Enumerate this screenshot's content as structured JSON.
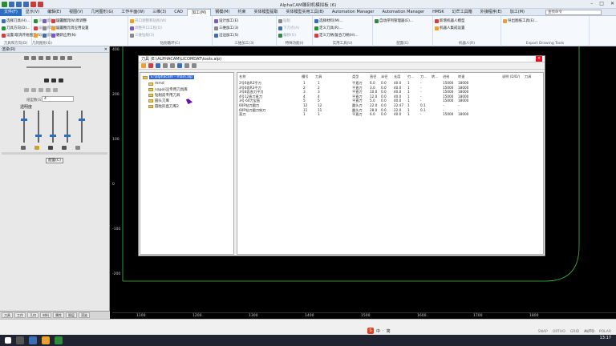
{
  "window": {
    "title": "AlphaCAM雕刻机模拟板 (6)"
  },
  "menu": {
    "tabs": [
      "文件(F)",
      "显示(V)",
      "编辑(E)",
      "视图(V)",
      "几何图形(G)",
      "工作平面(W)",
      "三维(3)",
      "CAD",
      "加工(M)",
      "钢模(M)",
      "约束",
      "实体模型提取",
      "实体模型实用工具(B)",
      "Automation Manager",
      "Automation Manager",
      "HMSK",
      "幻芒工具箱",
      "外接程序(E)",
      "加工(M)"
    ],
    "active_index": 8,
    "search_placeholder": "查找命令"
  },
  "ribbon": {
    "groups": [
      {
        "label": "刀具和方向(D)",
        "items": [
          "选择刀具(H)...",
          "刀具方向(D)...",
          "设置/取消开始图元(S)"
        ]
      },
      {
        "label": "几何图形(G)",
        "items": [
          "添加加工(A)...",
          "编辑加工(E)...",
          "三维加工(3)...",
          "粗加工和加工(R)...",
          "平面加工(P)...",
          "删除(D)"
        ]
      },
      {
        "label": "",
        "items": [
          "设置图元(V)周调整",
          "设置图元周应用设置",
          "更新应用(N)"
        ]
      },
      {
        "label": "钻削循环(C)",
        "items": [
          "开口调整和钻削(W)",
          "调整开口工程(D)",
          "三维钻削(3)"
        ]
      },
      {
        "label": "三维加工(3)",
        "items": [
          "设计加工(E)",
          "三维加工(3)",
          "沿边加工(S)"
        ]
      },
      {
        "label": "特殊功能(I)",
        "items": [
          "钻削",
          "下刀点(A)",
          "偏移(O)"
        ]
      },
      {
        "label": "实用工具(U)",
        "items": [
          "选择材料(M)...",
          "定义刀具(R)...",
          "定义刀柄/复合刀柄(H)..."
        ]
      },
      {
        "label": "配置(E)",
        "items": [
          "自动序列管理器(E)..."
        ]
      },
      {
        "label": "机器人(R)",
        "items": [
          "新增机器人模型",
          "机器人集成设置"
        ]
      },
      {
        "label": "Export Drawing Tools",
        "items": [
          "导出图纸工具(E)..."
        ]
      }
    ]
  },
  "left_panel": {
    "title": "渲染(R)",
    "paper_label": "纸型数(S)",
    "paper_value": "4",
    "transparency_label": "透明度",
    "sliders": [
      0.75,
      0.25,
      0.25,
      0.25,
      0.75
    ],
    "apply_label": "配置(C)",
    "tabs": [
      "刀具",
      "工作",
      "几何",
      "材料",
      "属性",
      "图层",
      "渲染"
    ]
  },
  "canvas": {
    "ruler_bottom": [
      "1100",
      "1200",
      "1300",
      "1400",
      "1500",
      "1600",
      "1700",
      "1800"
    ],
    "ruler_left": [
      "400",
      "200",
      "100",
      "0",
      "-100",
      "-200"
    ],
    "line_color": "#3fbf3f"
  },
  "dialog": {
    "title": "刀具 (E:\\ALPHACAM\\LICOMDAT\\tools.alp)",
    "close_label": "×",
    "tree": {
      "root": "E:\\alphacam - main.alp",
      "children": [
        "mmd",
        "napoli沿专用刀具库",
        "钻削前专用刀具",
        "圆头刀库",
        "圆柱形直刀库2"
      ]
    },
    "table": {
      "headers": [
        "名称",
        "槽号",
        "刀具",
        "",
        "",
        "类型",
        "直径",
        "半径",
        "长度",
        "刃...",
        "刀...",
        "转...",
        "进给",
        "转速",
        "",
        "",
        "",
        "",
        "",
        " ",
        "说明 (D/D/)",
        "刀具"
      ],
      "rows": [
        [
          "2号6齿R2平刀",
          "1",
          "1",
          "平直刀",
          "6.0",
          "0.0",
          "40.0",
          "1",
          "-",
          "15000",
          "18000"
        ],
        [
          "3号6齿R3平刀",
          "2",
          "2",
          "平直刀",
          "3.0",
          "0.0",
          "40.0",
          "1",
          "-",
          "15000",
          "18000"
        ],
        [
          "3号8齿直刀平刀",
          "3",
          "3",
          "平直刀",
          "10.0",
          "0.0",
          "40.0",
          "1",
          "-",
          "15000",
          "18000"
        ],
        [
          "4号12直刀直刀",
          "4",
          "4",
          "平直刀",
          "12.0",
          "0.0",
          "40.0",
          "1",
          "-",
          "15000",
          "18000"
        ],
        [
          "3号 60刀宝直",
          "5",
          "5",
          "平直刀",
          "5.0",
          "0.0",
          "40.0",
          "1",
          "-",
          "15000",
          "18000"
        ],
        [
          "60R钻刀圆刀",
          "12",
          "12",
          "圆头刀",
          "22.0",
          "0.0",
          "22.47",
          "1",
          "0.1",
          "-",
          "-"
        ],
        [
          "60R钻刀圆刀斜刀",
          "11",
          "11",
          "圆头刀",
          "28.0",
          "0.0",
          "22.0",
          "1",
          "0.1",
          "-",
          "-"
        ],
        [
          "直刀",
          "1",
          "1",
          "平直刀",
          "6.0",
          "0.0",
          "40.0",
          "1",
          "-",
          "15000",
          "18000"
        ]
      ]
    }
  },
  "statusbar": {
    "modes": [
      "SNAP",
      "ORTHO",
      "GRID",
      "AUTO",
      "POLAR"
    ],
    "active_mode": "AUTO",
    "ime": [
      "中",
      "·",
      "",
      "",
      "简"
    ]
  },
  "taskbar": {
    "time": "13:17",
    "date": "2023"
  }
}
